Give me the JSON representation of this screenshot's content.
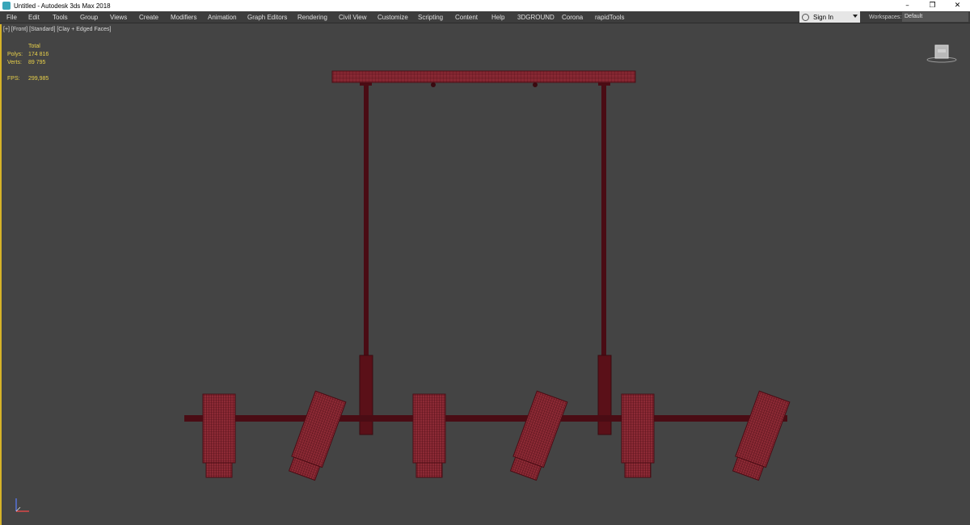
{
  "window": {
    "title": "Untitled - Autodesk 3ds Max 2018",
    "controls": {
      "minimize": "–",
      "restore": "❐",
      "close": "✕"
    }
  },
  "menu": [
    "File",
    "Edit",
    "Tools",
    "Group",
    "Views",
    "Create",
    "Modifiers",
    "Animation",
    "Graph Editors",
    "Rendering",
    "Civil View",
    "Customize",
    "Scripting",
    "Content",
    "Help",
    "3DGROUND",
    "Corona",
    "rapidTools"
  ],
  "account": {
    "signin_label": "Sign In"
  },
  "workspace": {
    "label": "Workspaces:",
    "value": "Default"
  },
  "viewport": {
    "label": "[+] [Front] [Standard] [Clay + Edged Faces]",
    "stats": {
      "header": "Total",
      "polys_label": "Polys:",
      "polys_value": "174 816",
      "verts_label": "Verts:",
      "verts_value": "89 795",
      "fps_label": "FPS:",
      "fps_value": "299,985"
    },
    "border_color": "#d6b228",
    "background": "#444444",
    "model_color": "#8c2a35",
    "wire_color": "#4a0c14"
  }
}
